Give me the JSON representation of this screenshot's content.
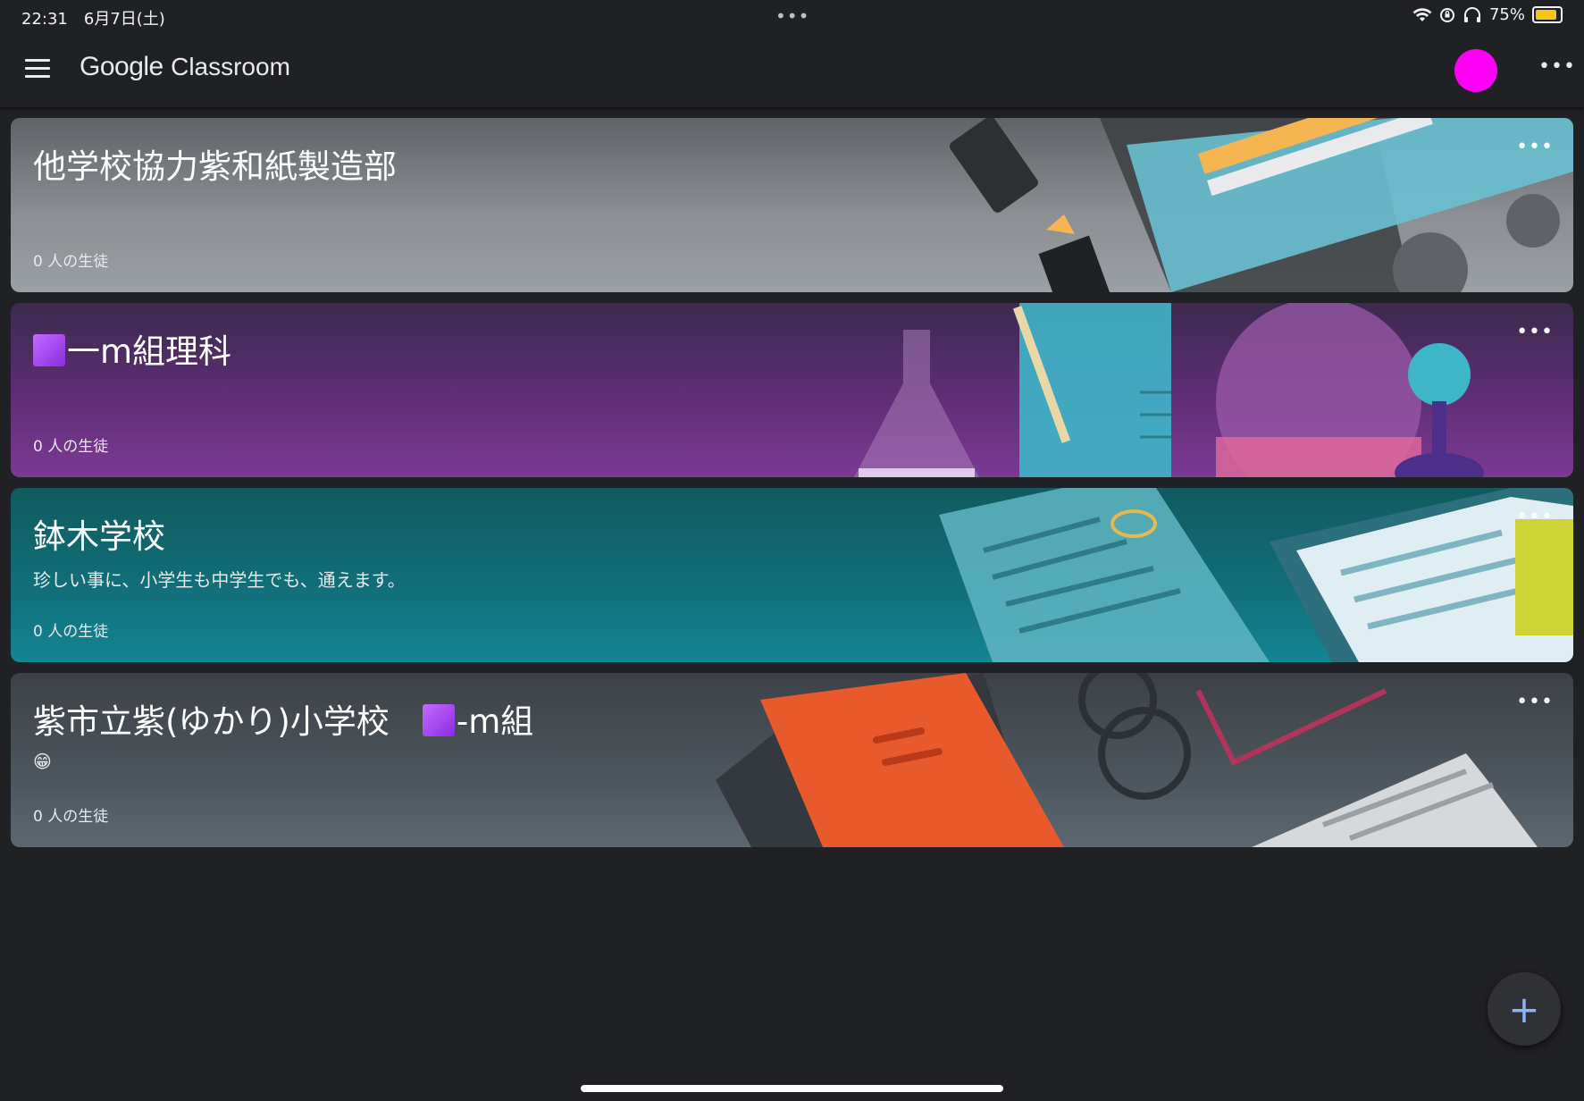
{
  "status_bar": {
    "time": "22:31",
    "date": "6月7日(土)",
    "dots": "•••",
    "battery_percent": "75%",
    "battery_level": 0.75,
    "icons": [
      "wifi-icon",
      "orientation-lock-icon",
      "headphones-icon",
      "battery-icon"
    ]
  },
  "app_bar": {
    "brand_google": "Google",
    "brand_product": "Classroom",
    "avatar_color": "#ff00f5",
    "more": "•••"
  },
  "cards": [
    {
      "title": "他学校協力紫和紙製造部",
      "subtitle": "",
      "students": "0 人の生徒",
      "theme": "gray",
      "more": "•••"
    },
    {
      "title": "一m組理科",
      "subtitle": "",
      "students": "0 人の生徒",
      "theme": "purple",
      "more": "•••"
    },
    {
      "title": "鉢木学校",
      "subtitle": "珍しい事に、小学生も中学生でも、通えます。",
      "students": "0 人の生徒",
      "theme": "teal",
      "more": "•••"
    },
    {
      "title_a": "紫市立紫(ゆかり)小学校　",
      "title_b": "-m組",
      "subtitle": "😁",
      "students": "0 人の生徒",
      "theme": "slate",
      "more": "•••"
    }
  ],
  "fab": {
    "label": "+"
  },
  "colors": {
    "background": "#202124",
    "accent": "#8ab4f8"
  }
}
